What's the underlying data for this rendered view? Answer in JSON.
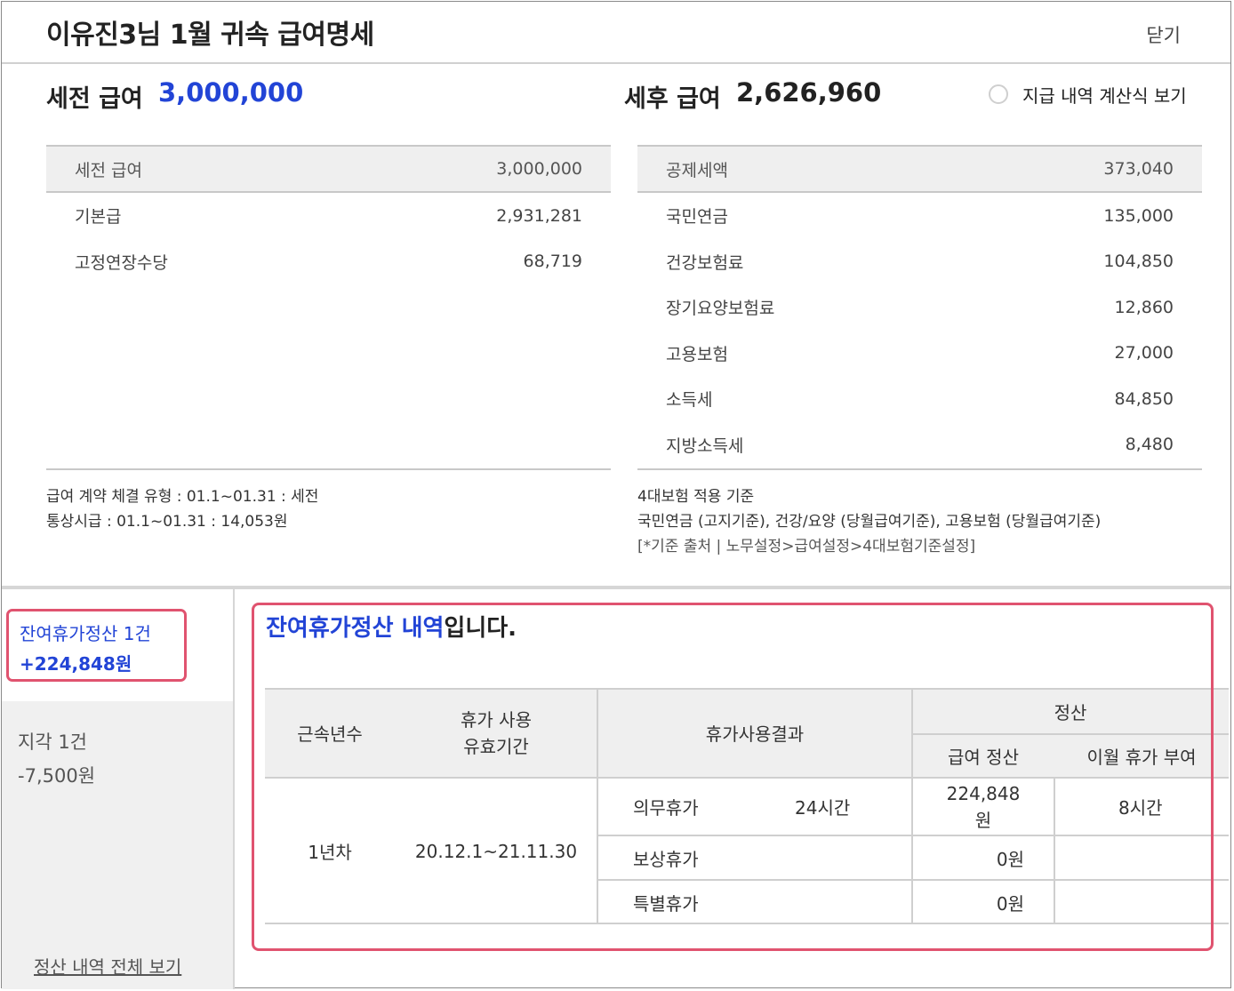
{
  "header": {
    "title": "이유진3님 1월 귀속 급여명세",
    "close_label": "닫기"
  },
  "summary": {
    "pre_tax_label": "세전 급여",
    "pre_tax_value": "3,000,000",
    "post_tax_label": "세후 급여",
    "post_tax_value": "2,626,960",
    "formula_toggle_label": "지급 내역 계산식 보기"
  },
  "earnings": {
    "header": {
      "label": "세전 급여",
      "value": "3,000,000"
    },
    "rows": [
      {
        "label": "기본급",
        "value": "2,931,281"
      },
      {
        "label": "고정연장수당",
        "value": "68,719"
      }
    ]
  },
  "deductions": {
    "header": {
      "label": "공제세액",
      "value": "373,040"
    },
    "rows": [
      {
        "label": "국민연금",
        "value": "135,000"
      },
      {
        "label": "건강보험료",
        "value": "104,850"
      },
      {
        "label": "장기요양보험료",
        "value": "12,860"
      },
      {
        "label": "고용보험",
        "value": "27,000"
      },
      {
        "label": "소득세",
        "value": "84,850"
      },
      {
        "label": "지방소득세",
        "value": "8,480"
      }
    ]
  },
  "notes": {
    "left_line1": "급여 계약 체결 유형 : 01.1~01.31 : 세전",
    "left_line2": "통상시급 : 01.1~01.31 : 14,053원",
    "right_line1": "4대보험 적용 기준",
    "right_line2": "국민연금 (고지기준), 건강/요양 (당월급여기준), 고용보험 (당월급여기준)",
    "right_line3": "[*기준 출처 | 노무설정>급여설정>4대보험기준설정]"
  },
  "sidebar": {
    "active_item": {
      "line1": "잔여휴가정산 1건",
      "line2": "+224,848원"
    },
    "item2": {
      "line1": "지각 1건",
      "line2": "-7,500원"
    },
    "view_all_label": "정산 내역 전체 보기"
  },
  "settlement": {
    "title_highlight": "잔여휴가정산 내역",
    "title_rest": "입니다.",
    "headers": {
      "years": "근속년수",
      "period_line1": "휴가 사용",
      "period_line2": "유효기간",
      "result": "휴가사용결과",
      "settle": "정산",
      "pay_settle": "급여 정산",
      "next_month": "이월 휴가 부여"
    },
    "years": "1년차",
    "period": "20.12.1~21.11.30",
    "rows": [
      {
        "type": "의무휴가",
        "hours": "24시간",
        "pay_line1": "224,848",
        "pay_line2": "원",
        "next_month": "8시간"
      },
      {
        "type": "보상휴가",
        "hours": "",
        "pay": "0원",
        "next_month": ""
      },
      {
        "type": "특별휴가",
        "hours": "",
        "pay": "0원",
        "next_month": ""
      }
    ]
  },
  "colors": {
    "accent_blue": "#2244d6",
    "highlight_border": "#e0536f",
    "header_bg": "#efefef"
  }
}
